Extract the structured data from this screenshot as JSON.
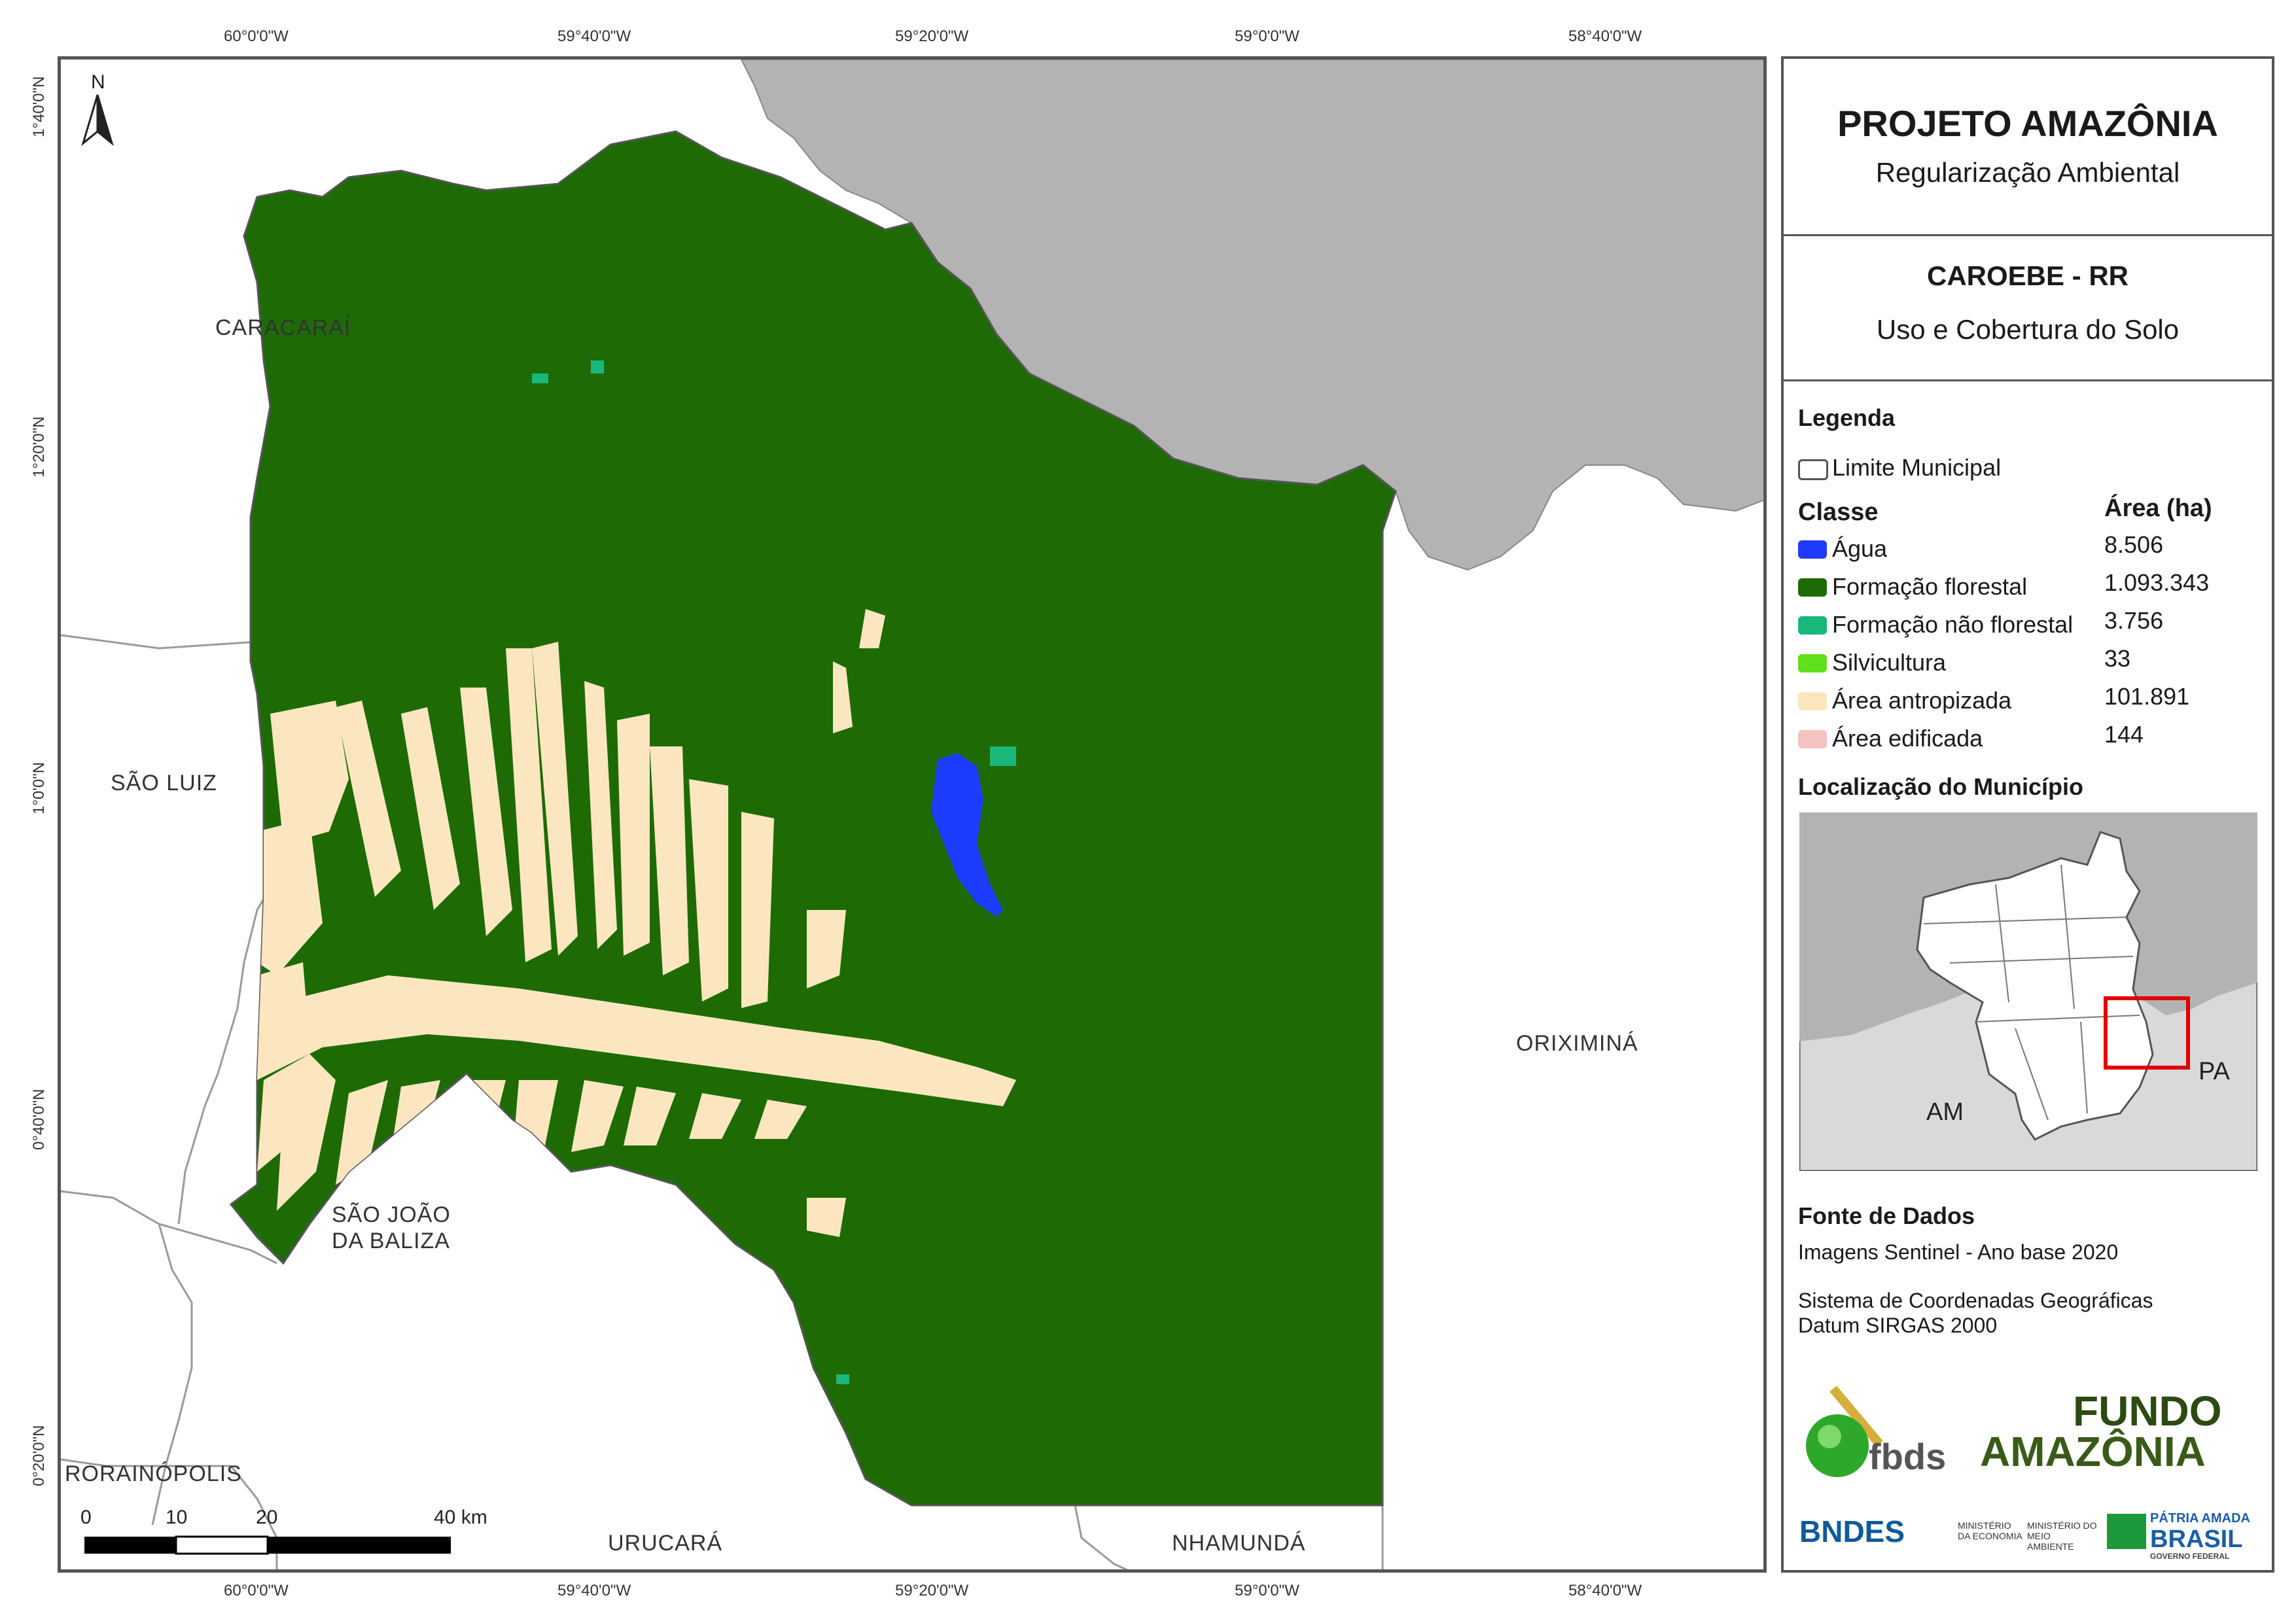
{
  "map": {
    "north_label": "N",
    "top_ticks": [
      "60°0'0\"W",
      "59°40'0\"W",
      "59°20'0\"W",
      "59°0'0\"W",
      "58°40'0\"W"
    ],
    "bottom_ticks": [
      "60°0'0\"W",
      "59°40'0\"W",
      "59°20'0\"W",
      "59°0'0\"W",
      "58°40'0\"W"
    ],
    "left_ticks": [
      "1°40'0\"N",
      "1°20'0\"N",
      "1°0'0\"N",
      "0°40'0\"N",
      "0°20'0\"N"
    ],
    "places": {
      "caracarai": "CARACARAÍ",
      "sao_luiz": "SÃO LUIZ",
      "sao_joao_1": "SÃO JOÃO",
      "sao_joao_2": "DA BALIZA",
      "rorainopolis": "RORAINÓPOLIS",
      "urucara": "URUCARÁ",
      "nhamunda": "NHAMUNDÁ",
      "oriximina": "ORIXIMINÁ"
    },
    "scale": {
      "labels": [
        "0",
        "10",
        "20",
        "40 km"
      ]
    },
    "colors": {
      "forest": "#1e6b06",
      "water": "#1e3cff",
      "anthropized": "#fbe6c0",
      "outside_gray": "#b3b3b3"
    }
  },
  "panel": {
    "title": "PROJETO AMAZÔNIA",
    "subtitle": "Regularização Ambiental",
    "municipality": "CAROEBE - RR",
    "theme": "Uso e Cobertura do Solo",
    "legend_title": "Legenda",
    "boundary_label": "Limite Municipal",
    "class_header": "Classe",
    "area_header": "Área (ha)",
    "classes": [
      {
        "label": "Água",
        "area": "8.506",
        "color": "#1e3cff"
      },
      {
        "label": "Formação florestal",
        "area": "1.093.343",
        "color": "#1e6b06"
      },
      {
        "label": "Formação não florestal",
        "area": "3.756",
        "color": "#19b77a"
      },
      {
        "label": "Silvicultura",
        "area": "33",
        "color": "#5fe01a"
      },
      {
        "label": "Área antropizada",
        "area": "101.891",
        "color": "#fbe6c0"
      },
      {
        "label": "Área edificada",
        "area": "144",
        "color": "#f5c2c2"
      }
    ],
    "location_title": "Localização do Município",
    "inset_labels": {
      "am": "AM",
      "pa": "PA"
    },
    "sources_title": "Fonte de Dados",
    "sources_line1": "Imagens Sentinel - Ano base 2020",
    "sources_line2": "Sistema de Coordenadas Geográficas",
    "sources_line3": "Datum SIRGAS 2000",
    "logos": {
      "fbds": "fbds",
      "fundo_1": "FUNDO",
      "fundo_2": "AMAZÔNIA",
      "bndes": "BNDES",
      "min_econ": "MINISTÉRIO DA ECONOMIA",
      "min_amb": "MINISTÉRIO DO MEIO AMBIENTE",
      "patria_1": "PÁTRIA AMADA",
      "patria_2": "BRASIL",
      "patria_3": "GOVERNO FEDERAL"
    }
  }
}
